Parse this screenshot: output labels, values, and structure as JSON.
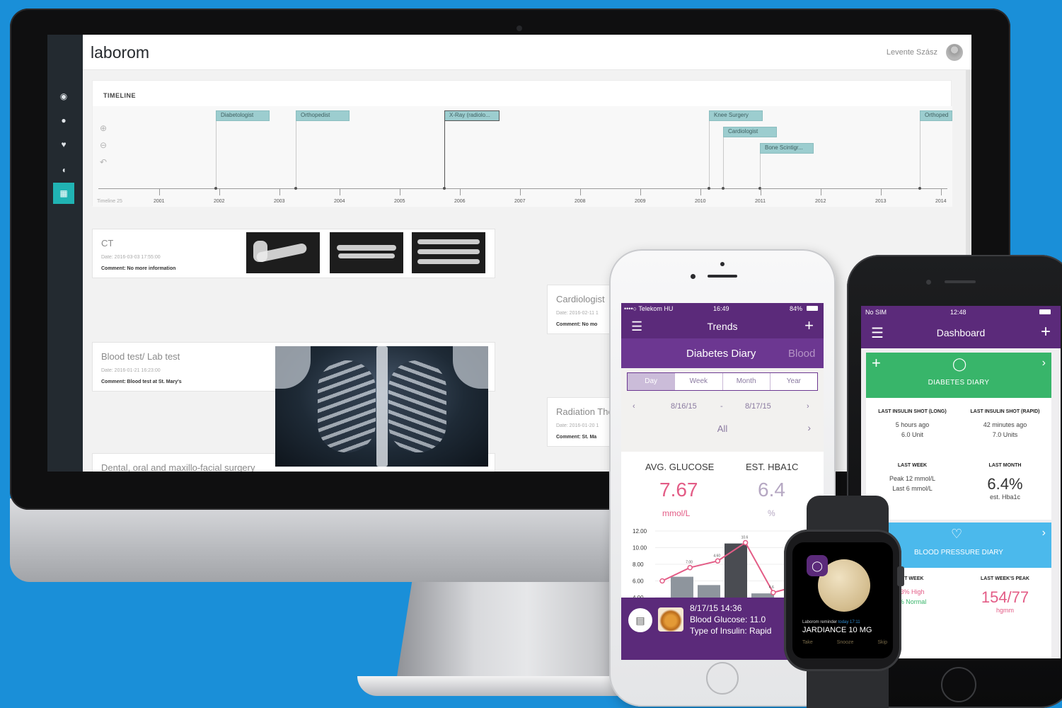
{
  "desktop": {
    "app_name": "laborom",
    "user_name": "Levente Szász",
    "nav_icons": [
      "camera-icon",
      "drop-icon",
      "heart-icon",
      "gauge-icon",
      "calendar-icon"
    ],
    "timeline": {
      "title": "TIMELINE",
      "events": [
        {
          "label": "Diabetologist"
        },
        {
          "label": "Orthopedist"
        },
        {
          "label": "X-Ray (radiolo..."
        },
        {
          "label": "Knee Surgery"
        },
        {
          "label": "Cardiologist"
        },
        {
          "label": "Bone Scintigr..."
        },
        {
          "label": "Orthoped"
        }
      ],
      "years": [
        "2001",
        "2002",
        "2003",
        "2004",
        "2005",
        "2006",
        "2007",
        "2008",
        "2009",
        "2010",
        "2011",
        "2012",
        "2013",
        "2014"
      ],
      "start_label": "Timeline 25"
    },
    "cards": [
      {
        "title": "CT",
        "date": "Date: 2016-03-03 17:55:00",
        "comment": "Comment: No more information"
      },
      {
        "title": "Cardiologist",
        "date": "Date: 2016-02-11 1",
        "comment": "Comment: No mo"
      },
      {
        "title": "Blood test/ Lab test",
        "date": "Date: 2016-01-21 16:23:00",
        "comment": "Comment: Blood test at St. Mary's"
      },
      {
        "title": "Radiation The",
        "date": "Date: 2016-01-20 1",
        "comment": "Comment: St. Ma"
      },
      {
        "title": "Dental, oral and maxillo-facial surgery"
      }
    ]
  },
  "phone1": {
    "status": {
      "carrier": "••••○ Telekom HU",
      "time": "16:49",
      "battery": "84%"
    },
    "nav_title": "Trends",
    "subnav": {
      "main": "Diabetes Diary",
      "next": "Blood"
    },
    "segments": [
      {
        "label": "Day",
        "active": true
      },
      {
        "label": "Week",
        "active": false
      },
      {
        "label": "Month",
        "active": false
      },
      {
        "label": "Year",
        "active": false
      }
    ],
    "date_from": "8/16/15",
    "date_sep": "-",
    "date_to": "8/17/15",
    "filter": "All",
    "stats": {
      "glucose_label": "AVG. GLUCOSE",
      "glucose_value": "7.67",
      "glucose_unit": "mmol/L",
      "hba1c_label": "EST. HBA1C",
      "hba1c_value": "6.4",
      "hba1c_unit": "%"
    },
    "chart_data": {
      "type": "bar",
      "y_ticks": [
        "12.00",
        "10.00",
        "8.00",
        "6.00",
        "4.00"
      ],
      "bar_values": [
        6.5,
        5.5,
        10.5,
        4.5
      ],
      "line_values": [
        6.0,
        7.6,
        8.4,
        10.6,
        4.6,
        5.5
      ],
      "point_labels": [
        "7.00",
        "4.60",
        "10.6",
        "4.6"
      ],
      "ylim": [
        4,
        12
      ]
    },
    "entry": {
      "datetime": "8/17/15 14:36",
      "glucose": "Blood Glucose: 11.0",
      "insulin": "Type of Insulin: Rapid"
    }
  },
  "phone2": {
    "status": {
      "carrier": "No SIM",
      "time": "12:48"
    },
    "nav_title": "Dashboard",
    "diabetes": {
      "label": "DIABETES DIARY",
      "long_header": "LAST INSULIN SHOT (LONG)",
      "long_value1": "5 hours ago",
      "long_value2": "6.0 Unit",
      "rapid_header": "LAST INSULIN SHOT (RAPID)",
      "rapid_value1": "42 minutes ago",
      "rapid_value2": "7.0 Units",
      "week_header": "LAST WEEK",
      "week_value1": "Peak 12 mmol/L",
      "week_value2": "Last 6 mmol/L",
      "month_header": "LAST MONTH",
      "month_value": "6.4%",
      "month_sub": "est. Hba1c"
    },
    "bp": {
      "label": "BLOOD PRESSURE DIARY",
      "week_header": "ST WEEK",
      "week_value1": "3% High",
      "week_value2": "% Normal",
      "peak_header": "LAST WEEK'S PEAK",
      "peak_value": "154/77",
      "peak_unit": "hgmm"
    }
  },
  "watch": {
    "reminder": "Laborom reminder",
    "reminder_time": "today 17:11",
    "drug": "JARDIANCE 10 MG",
    "actions": [
      "Take",
      "Snooze",
      "Skip"
    ]
  },
  "colors": {
    "purple": "#5b2a7a",
    "green": "#38b56a",
    "blue": "#4bb9ec",
    "teal": "#20b3b3",
    "pink": "#e35c86",
    "background": "#1a8fd8"
  }
}
